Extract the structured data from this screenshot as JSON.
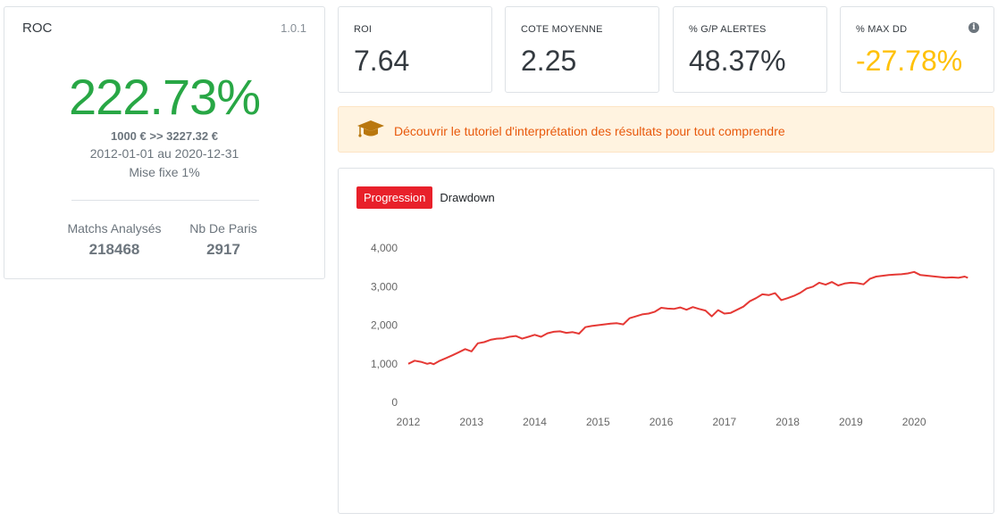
{
  "summary": {
    "title": "ROC",
    "version": "1.0.1",
    "roc_value": "222.73%",
    "capital": "1000 € >> 3227.32 €",
    "period": "2012-01-01 au 2020-12-31",
    "stake": "Mise fixe 1%",
    "matchs_label": "Matchs Analysés",
    "matchs_value": "218468",
    "paris_label": "Nb De Paris",
    "paris_value": "2917",
    "value_color": "#28a745"
  },
  "kpis": {
    "roi_label": "ROI",
    "roi_value": "7.64",
    "cote_label": "COTE MOYENNE",
    "cote_value": "2.25",
    "gp_label": "% G/P ALERTES",
    "gp_value": "48.37%",
    "dd_label": "% MAX DD",
    "dd_value": "-27.78%",
    "dd_color": "#ffc107",
    "dd_icon": "info-circle-icon"
  },
  "tutorial": {
    "icon": "graduation-cap-icon",
    "text": "Découvrir le tutoriel d'interprétation des résultats pour tout comprendre"
  },
  "tabs": [
    {
      "label": "Progression",
      "active": true
    },
    {
      "label": "Drawdown",
      "active": false
    }
  ],
  "chart_data": {
    "type": "line",
    "title": "",
    "xlabel": "",
    "ylabel": "",
    "xlim": [
      2012,
      2021.1
    ],
    "ylim": [
      0,
      4000
    ],
    "yticks": [
      0,
      1000,
      2000,
      3000,
      4000
    ],
    "ytick_labels": [
      "0",
      "1,000",
      "2,000",
      "3,000",
      "4,000"
    ],
    "xticks": [
      2012,
      2013,
      2014,
      2015,
      2016,
      2017,
      2018,
      2019,
      2020
    ],
    "xtick_labels": [
      "2012",
      "2013",
      "2014",
      "2015",
      "2016",
      "2017",
      "2018",
      "2019",
      "2020"
    ],
    "grid": false,
    "color": "#e53935",
    "series": [
      {
        "x": [
          2012.0,
          2012.1,
          2012.2,
          2012.3,
          2012.35,
          2012.4,
          2012.5,
          2012.6,
          2012.7,
          2012.8,
          2012.9,
          2013.0,
          2013.1,
          2013.2,
          2013.3,
          2013.4,
          2013.5,
          2013.6,
          2013.7,
          2013.8,
          2013.9,
          2014.0,
          2014.1,
          2014.2,
          2014.3,
          2014.4,
          2014.5,
          2014.6,
          2014.7,
          2014.8,
          2014.9,
          2015.0,
          2015.1,
          2015.2,
          2015.3,
          2015.4,
          2015.5,
          2015.6,
          2015.7,
          2015.8,
          2015.9,
          2016.0,
          2016.1,
          2016.2,
          2016.3,
          2016.4,
          2016.5,
          2016.6,
          2016.7,
          2016.8,
          2016.9,
          2017.0,
          2017.1,
          2017.2,
          2017.3,
          2017.4,
          2017.5,
          2017.6,
          2017.7,
          2017.8,
          2017.9,
          2018.0,
          2018.1,
          2018.2,
          2018.3,
          2018.4,
          2018.5,
          2018.6,
          2018.7,
          2018.8,
          2018.9,
          2019.0,
          2019.1,
          2019.2,
          2019.3,
          2019.4,
          2019.5,
          2019.6,
          2019.7,
          2019.8,
          2019.9,
          2020.0,
          2020.1,
          2020.5,
          2020.6,
          2020.7,
          2020.8,
          2020.85
        ],
        "y": [
          1000,
          1080,
          1050,
          1000,
          1020,
          990,
          1080,
          1150,
          1220,
          1300,
          1380,
          1320,
          1530,
          1560,
          1620,
          1650,
          1660,
          1700,
          1720,
          1650,
          1700,
          1750,
          1700,
          1790,
          1830,
          1840,
          1800,
          1820,
          1780,
          1950,
          1980,
          2000,
          2020,
          2040,
          2050,
          2020,
          2180,
          2230,
          2280,
          2300,
          2350,
          2450,
          2430,
          2420,
          2460,
          2400,
          2470,
          2420,
          2380,
          2230,
          2390,
          2300,
          2320,
          2400,
          2480,
          2620,
          2700,
          2800,
          2780,
          2830,
          2650,
          2700,
          2760,
          2840,
          2950,
          3000,
          3100,
          3050,
          3120,
          3030,
          3080,
          3100,
          3090,
          3060,
          3200,
          3260,
          3280,
          3300,
          3310,
          3320,
          3340,
          3380,
          3300,
          3230,
          3240,
          3228,
          3260,
          3227
        ]
      }
    ]
  }
}
